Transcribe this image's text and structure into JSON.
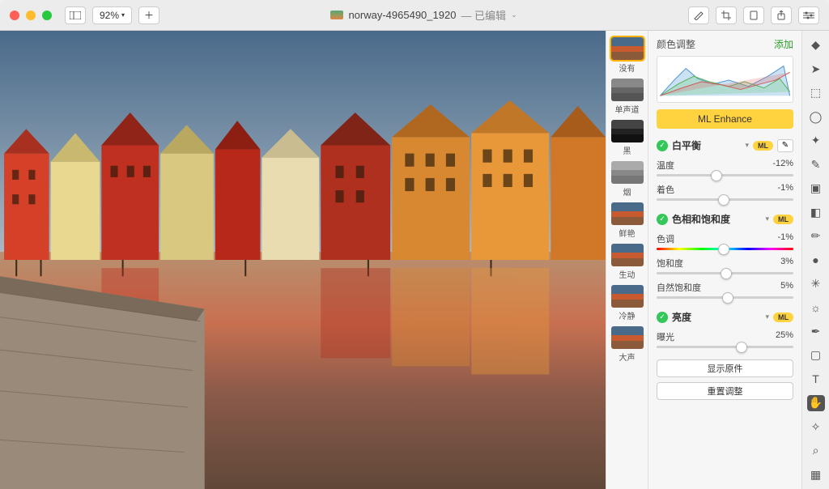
{
  "titlebar": {
    "zoom": "92%",
    "filename": "norway-4965490_1920",
    "edited": "— 已编辑"
  },
  "presets": [
    {
      "label": "没有",
      "cls": "th-color",
      "active": true
    },
    {
      "label": "单声道",
      "cls": "th-gray"
    },
    {
      "label": "黑",
      "cls": "th-dark"
    },
    {
      "label": "烟",
      "cls": "th-smoke"
    },
    {
      "label": "鲜艳",
      "cls": "th-color"
    },
    {
      "label": "生动",
      "cls": "th-color"
    },
    {
      "label": "冷静",
      "cls": "th-color"
    },
    {
      "label": "大声",
      "cls": "th-color"
    }
  ],
  "panel": {
    "title": "颜色调整",
    "add": "添加",
    "ml_enhance": "ML Enhance",
    "ml_badge": "ML",
    "show_original": "显示原件",
    "reset": "重置调整",
    "sections": {
      "white_balance": {
        "title": "白平衡",
        "ml": true,
        "picker": true,
        "sliders": [
          {
            "label": "温度",
            "value": "-12%",
            "pos": 44
          },
          {
            "label": "着色",
            "value": "-1%",
            "pos": 49
          }
        ]
      },
      "hue_sat": {
        "title": "色相和饱和度",
        "ml": true,
        "sliders": [
          {
            "label": "色调",
            "value": "-1%",
            "pos": 49,
            "hue": true
          },
          {
            "label": "饱和度",
            "value": "3%",
            "pos": 51
          },
          {
            "label": "自然饱和度",
            "value": "5%",
            "pos": 52
          }
        ]
      },
      "brightness": {
        "title": "亮度",
        "ml": true,
        "sliders": [
          {
            "label": "曝光",
            "value": "25%",
            "pos": 62
          }
        ]
      }
    }
  },
  "tools": [
    {
      "name": "pointer-icon",
      "g": "◆"
    },
    {
      "name": "arrow-icon",
      "g": "➤"
    },
    {
      "name": "marquee-icon",
      "g": "⬚"
    },
    {
      "name": "lasso-icon",
      "g": "◯"
    },
    {
      "name": "wand-icon",
      "g": "✦"
    },
    {
      "name": "brush-icon",
      "g": "✎"
    },
    {
      "name": "bucket-icon",
      "g": "▣"
    },
    {
      "name": "eraser-icon",
      "g": "◧"
    },
    {
      "name": "pen-icon",
      "g": "✏"
    },
    {
      "name": "smudge-icon",
      "g": "●"
    },
    {
      "name": "sharpen-icon",
      "g": "✳"
    },
    {
      "name": "light-icon",
      "g": "☼"
    },
    {
      "name": "dropper-icon",
      "g": "✒"
    },
    {
      "name": "shape-icon",
      "g": "▢"
    },
    {
      "name": "text-icon",
      "g": "T"
    },
    {
      "name": "hand-icon",
      "g": "✋",
      "active": true
    },
    {
      "name": "star-icon",
      "g": "✧"
    },
    {
      "name": "zoom-icon",
      "g": "⌕"
    },
    {
      "name": "swatch-icon",
      "g": "▦"
    }
  ]
}
